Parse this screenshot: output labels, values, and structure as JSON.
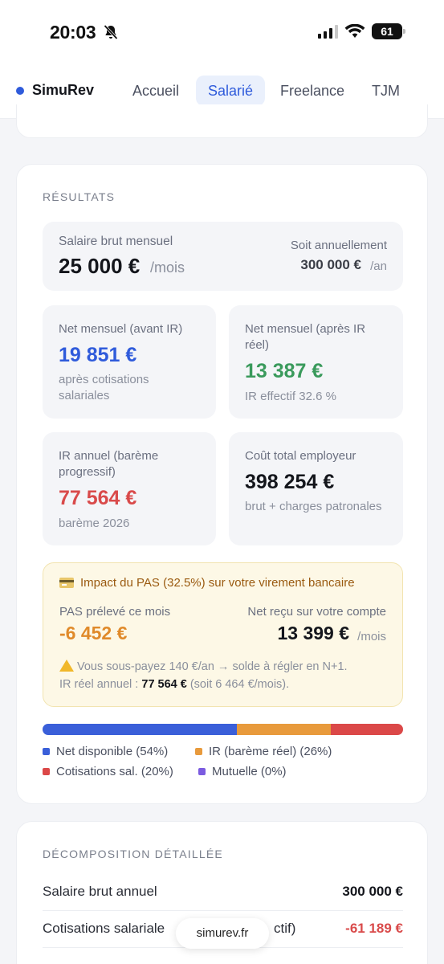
{
  "status_bar": {
    "time": "20:03",
    "battery": "61"
  },
  "nav": {
    "brand": "SimuRev",
    "tabs": [
      {
        "label": "Accueil",
        "active": false
      },
      {
        "label": "Salarié",
        "active": true
      },
      {
        "label": "Freelance",
        "active": false
      },
      {
        "label": "TJM",
        "active": false
      }
    ]
  },
  "results": {
    "title": "RÉSULTATS",
    "gross": {
      "label": "Salaire brut mensuel",
      "value": "25 000 €",
      "unit": "/mois",
      "annual_label": "Soit annuellement",
      "annual_value": "300 000 €",
      "annual_unit": "/an"
    },
    "net_before": {
      "label": "Net mensuel (avant IR)",
      "value": "19 851 €",
      "sub": "après cotisations salariales"
    },
    "net_after": {
      "label": "Net mensuel (après IR réel)",
      "value": "13 387 €",
      "sub": "IR effectif 32.6 %"
    },
    "ir_annual": {
      "label": "IR annuel (barème progressif)",
      "value": "77 564 €",
      "sub": "barème 2026"
    },
    "employer_cost": {
      "label": "Coût total employeur",
      "value": "398 254 €",
      "sub": "brut + charges patronales"
    },
    "pas": {
      "title": "Impact du PAS (32.5%) sur votre virement bancaire",
      "withheld_label": "PAS prélevé ce mois",
      "withheld_value": "-6 452 €",
      "received_label": "Net reçu sur votre compte",
      "received_value": "13 399 €",
      "received_unit": "/mois",
      "warn_line1": "Vous sous-payez 140 €/an → solde à régler en N+1.",
      "warn_line2_prefix": "IR réel annuel : ",
      "warn_line2_bold": "77 564 €",
      "warn_line2_suffix": " (soit 6 464 €/mois)."
    },
    "breakdown": [
      {
        "label": "Net disponible (54%)",
        "fraction": 0.54,
        "color": "#3a5fd9"
      },
      {
        "label": "IR (barème réel) (26%)",
        "fraction": 0.26,
        "color": "#e89a3c"
      },
      {
        "label": "Cotisations sal. (20%)",
        "fraction": 0.2,
        "color": "#db4848"
      },
      {
        "label": "Mutuelle (0%)",
        "fraction": 0.0,
        "color": "#7b5be0"
      }
    ]
  },
  "decomposition": {
    "title": "DÉCOMPOSITION DÉTAILLÉE",
    "rows": [
      {
        "label": "Salaire brut annuel",
        "value": "300 000 €"
      },
      {
        "label": "Cotisations salariale",
        "suffix": "ctif)",
        "value": "-61 189 €"
      }
    ]
  },
  "footer": {
    "site": "simurev.fr"
  },
  "colors": {
    "accent": "#2f5bdb",
    "green": "#3a9a5c",
    "red": "#d94a4a",
    "orange": "#e08a2a"
  }
}
